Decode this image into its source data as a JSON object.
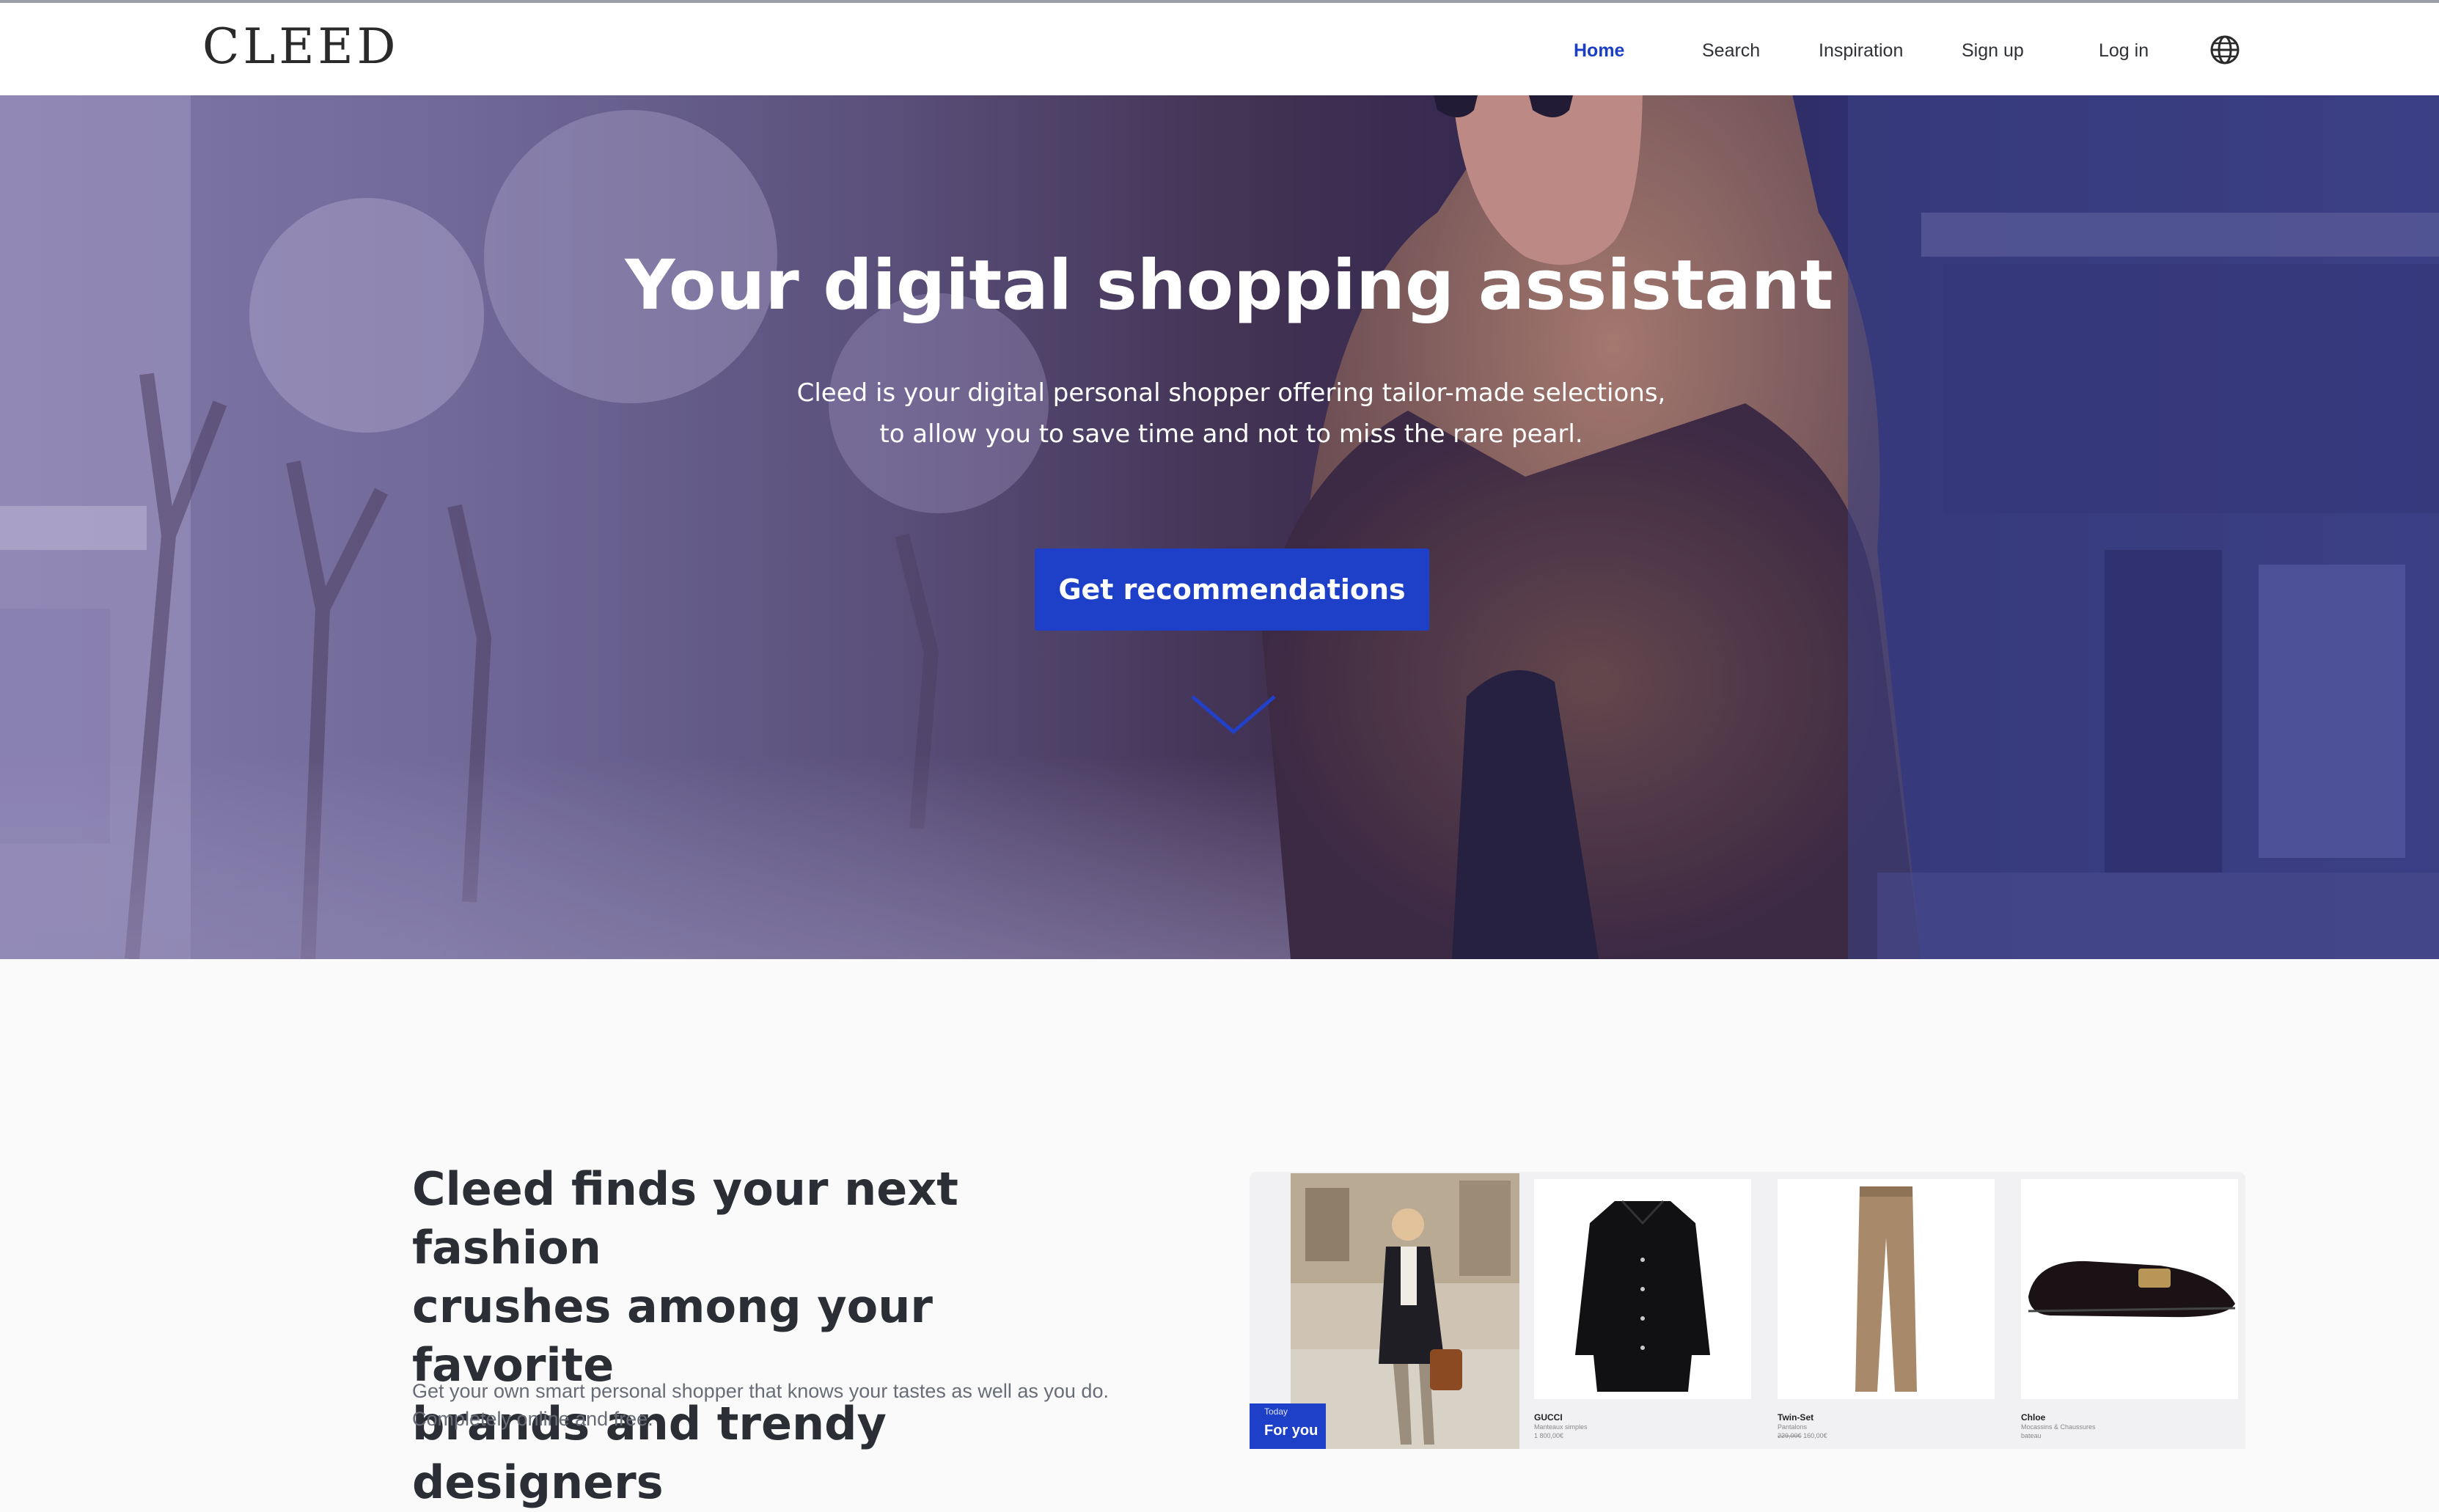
{
  "brand": {
    "logo": "CLEED"
  },
  "nav": {
    "items": [
      {
        "label": "Home",
        "active": true
      },
      {
        "label": "Search"
      },
      {
        "label": "Inspiration"
      },
      {
        "label": "Sign up"
      },
      {
        "label": "Log in"
      }
    ],
    "language_icon": "globe-icon"
  },
  "hero": {
    "title": "Your digital shopping assistant",
    "subtitle_lines": [
      "Cleed is your digital personal shopper offering tailor-made selections,",
      "to allow you to save time and not to miss the rare pearl."
    ],
    "cta_label": "Get recommendations",
    "scroll_icon": "chevron-down-icon"
  },
  "feature": {
    "title_lines": [
      "Cleed finds your next fashion",
      "crushes among your favorite",
      "brands and trendy designers"
    ],
    "description_lines": [
      "Get your own smart personal shopper that knows your tastes as well as you do.",
      "Completely online and free."
    ]
  },
  "showcase": {
    "badge_small": "Today",
    "badge_big": "For you",
    "products": [
      {
        "brand": "GUCCI",
        "category": "Manteaux simples",
        "price": "1 800,00€"
      },
      {
        "brand": "Twin-Set",
        "category": "Pantalons",
        "old_price": "229,00€",
        "price": "160,00€"
      },
      {
        "brand": "Chloe",
        "category": "Mocassins & Chaussures",
        "extra": "bateau"
      }
    ]
  },
  "colors": {
    "accent": "#1e40c8",
    "nav_active": "#1b3ec4",
    "text_dark": "#2c2e36",
    "text_muted": "#686c76",
    "background": "#fafafb"
  }
}
